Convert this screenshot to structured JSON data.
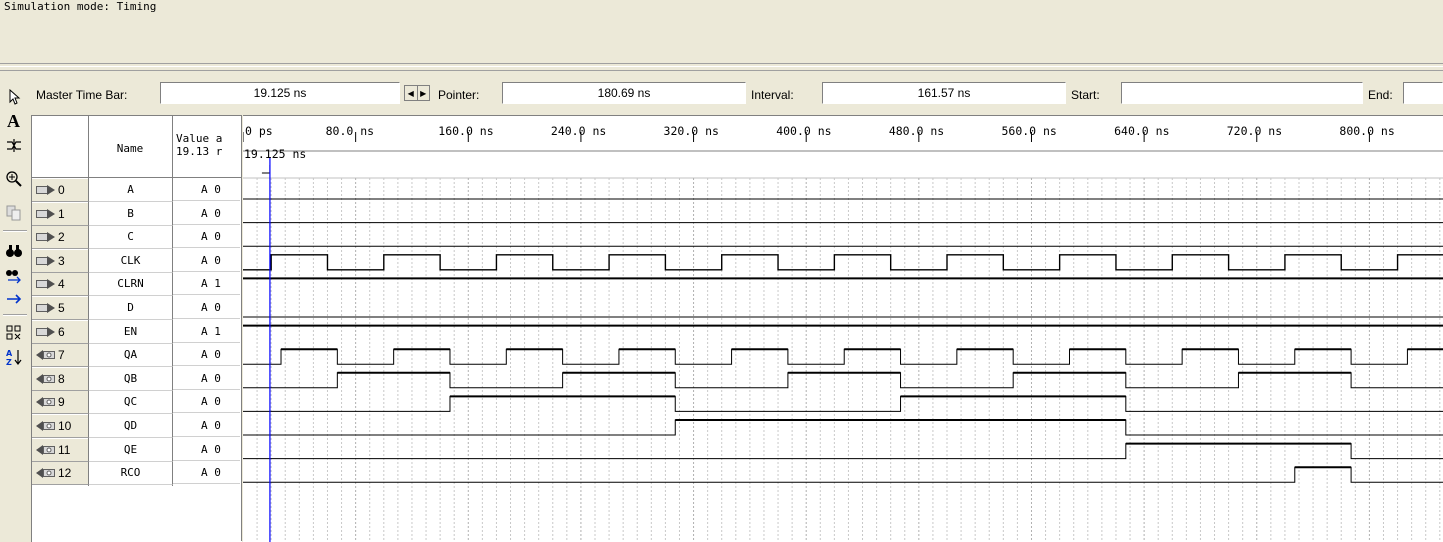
{
  "status": {
    "message": "Simulation mode: Timing"
  },
  "timebar": {
    "master_label": "Master Time Bar:",
    "master_value": "19.125 ns",
    "pointer_label": "Pointer:",
    "pointer_value": "180.69 ns",
    "interval_label": "Interval:",
    "interval_value": "161.57 ns",
    "start_label": "Start:",
    "start_value": "",
    "end_label": "End:",
    "end_value": ""
  },
  "toolbar": {
    "icons": [
      "pointer-icon",
      "text-tool-icon",
      "waveform-editing-icon",
      "zoom-icon",
      "copy-icon",
      "find-icon",
      "find-next-icon",
      "goto-icon",
      "group-icon",
      "sort-icon"
    ]
  },
  "table": {
    "name_header": "Name",
    "value_header": "Value a\n19.13 r",
    "rows": [
      {
        "index": "0",
        "name": "A",
        "value": "A 0",
        "type": "input"
      },
      {
        "index": "1",
        "name": "B",
        "value": "A 0",
        "type": "input"
      },
      {
        "index": "2",
        "name": "C",
        "value": "A 0",
        "type": "input"
      },
      {
        "index": "3",
        "name": "CLK",
        "value": "A 0",
        "type": "input"
      },
      {
        "index": "4",
        "name": "CLRN",
        "value": "A 1",
        "type": "input"
      },
      {
        "index": "5",
        "name": "D",
        "value": "A 0",
        "type": "input"
      },
      {
        "index": "6",
        "name": "EN",
        "value": "A 1",
        "type": "input"
      },
      {
        "index": "7",
        "name": "QA",
        "value": "A 0",
        "type": "output"
      },
      {
        "index": "8",
        "name": "QB",
        "value": "A 0",
        "type": "output"
      },
      {
        "index": "9",
        "name": "QC",
        "value": "A 0",
        "type": "output"
      },
      {
        "index": "10",
        "name": "QD",
        "value": "A 0",
        "type": "output"
      },
      {
        "index": "11",
        "name": "QE",
        "value": "A 0",
        "type": "output"
      },
      {
        "index": "12",
        "name": "RCO",
        "value": "A 0",
        "type": "output"
      }
    ]
  },
  "waveform": {
    "time_labels": [
      "0 ps",
      "80.0 ns",
      "160.0 ns",
      "240.0 ns",
      "320.0 ns",
      "400.0 ns",
      "480.0 ns",
      "560.0 ns",
      "640.0 ns",
      "720.0 ns",
      "800.0 ns"
    ],
    "time_step_ns": 80,
    "cursor_label": "19.125 ns",
    "cursor_ns": 19.125,
    "accent_cursor_color": "#0000ff",
    "signals": [
      {
        "name": "A",
        "level": 0
      },
      {
        "name": "B",
        "level": 0
      },
      {
        "name": "C",
        "level": 0
      },
      {
        "name": "CLK",
        "clock": true,
        "period_ns": 80,
        "first_rise_ns": 20
      },
      {
        "name": "CLRN",
        "level": 1
      },
      {
        "name": "D",
        "level": 0
      },
      {
        "name": "EN",
        "level": 1
      },
      {
        "name": "QA",
        "initial": 0,
        "toggles_ns": [
          27,
          67,
          107,
          147,
          187,
          227,
          267,
          307,
          347,
          387,
          427,
          467,
          507,
          547,
          587,
          627,
          667,
          707,
          747,
          787,
          827,
          867
        ]
      },
      {
        "name": "QB",
        "initial": 0,
        "toggles_ns": [
          67,
          147,
          227,
          307,
          387,
          467,
          547,
          627,
          707,
          787
        ]
      },
      {
        "name": "QC",
        "initial": 0,
        "toggles_ns": [
          147,
          307,
          467,
          627
        ]
      },
      {
        "name": "QD",
        "initial": 0,
        "toggles_ns": [
          307,
          627
        ]
      },
      {
        "name": "QE",
        "initial": 0,
        "toggles_ns": [
          627,
          787
        ]
      },
      {
        "name": "RCO",
        "initial": 0,
        "toggles_ns": [
          747,
          787
        ]
      }
    ]
  }
}
